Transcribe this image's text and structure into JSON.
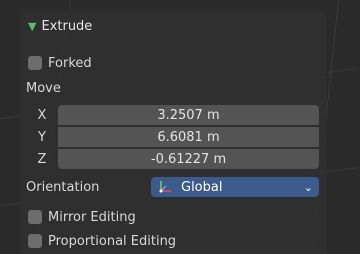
{
  "panel": {
    "title": "Extrude",
    "forked_label": "Forked",
    "move_label": "Move",
    "x_label": "X",
    "x_value": "3.2507 m",
    "y_label": "Y",
    "y_value": "6.6081 m",
    "z_label": "Z",
    "z_value": "-0.61227 m",
    "orientation_label": "Orientation",
    "orientation_value": "Global",
    "mirror_label": "Mirror Editing",
    "proportional_label": "Proportional Editing"
  },
  "icons": {
    "collapse": "triangle-down-icon",
    "orientation": "global-axes-icon",
    "dropdown": "chevron-down-icon"
  },
  "colors": {
    "accent": "#4fc26b",
    "dropdown_bg": "#3d5a8c",
    "field_bg": "#545454"
  }
}
